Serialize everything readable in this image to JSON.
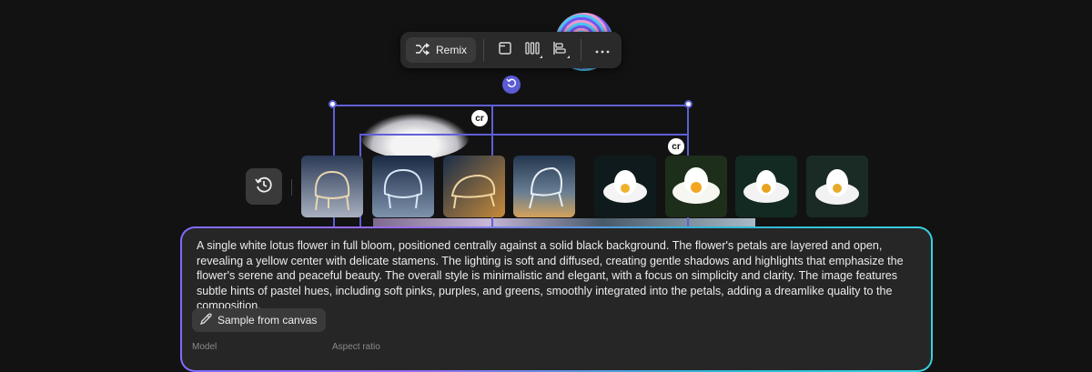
{
  "toolbar": {
    "remix_label": "Remix",
    "icons": [
      "remix-icon",
      "artboard-icon",
      "columns-icon",
      "align-icon",
      "more-icon"
    ]
  },
  "canvas": {
    "badge_label": "cr"
  },
  "thumbnails": {
    "chairs": [
      "chair-1",
      "chair-2",
      "chair-3",
      "chair-4"
    ],
    "lotuses": [
      "lotus-1",
      "lotus-2",
      "lotus-3",
      "lotus-4"
    ]
  },
  "prompt": {
    "text": "A single white lotus flower in full bloom, positioned centrally against a solid black background. The flower's petals are layered and open, revealing a yellow center with delicate stamens. The lighting is soft and diffused, creating gentle shadows and highlights that emphasize the flower's serene and peaceful beauty. The overall style is minimalistic and elegant, with a focus on simplicity and clarity. The image features subtle hints of pastel hues, including soft pinks, purples, and greens, smoothly integrated into the petals, adding a dreamlike quality to the composition.",
    "sample_button_label": "Sample from canvas",
    "model_label": "Model",
    "aspect_ratio_label": "Aspect ratio"
  },
  "colors": {
    "accent": "#5f5fd8",
    "background": "#121212",
    "panel": "#262626"
  }
}
